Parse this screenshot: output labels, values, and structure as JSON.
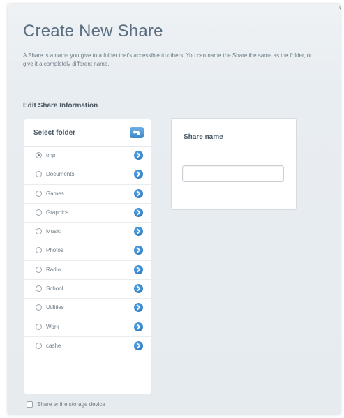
{
  "dialog": {
    "corner_text": "Cl",
    "title": "Create New Share",
    "description": "A Share is a name you give to a folder that's accessible to others. You can name the Share the same as the folder, or give it a completely different name."
  },
  "section": {
    "heading": "Edit Share Information"
  },
  "folder_panel": {
    "header": "Select folder",
    "up_icon": "folder-up-arrow-icon",
    "open_icon": "chevron-right-circle-icon",
    "selected_folder": "tmp",
    "folders": [
      {
        "name": "tmp"
      },
      {
        "name": "Documents"
      },
      {
        "name": "Games"
      },
      {
        "name": "Graphics"
      },
      {
        "name": "Music"
      },
      {
        "name": "Photos"
      },
      {
        "name": "Radio"
      },
      {
        "name": "School"
      },
      {
        "name": "Utilities"
      },
      {
        "name": "Work"
      },
      {
        "name": "cashe"
      }
    ]
  },
  "share_panel": {
    "label": "Share name",
    "input_value": "",
    "input_placeholder": ""
  },
  "entire_device": {
    "label": "Share entire storage device",
    "checked": false
  },
  "colors": {
    "title": "#5b6f80",
    "accent_blue": "#2f7fc4",
    "panel_border": "#d6dbe0",
    "background": "#e8edf1"
  }
}
